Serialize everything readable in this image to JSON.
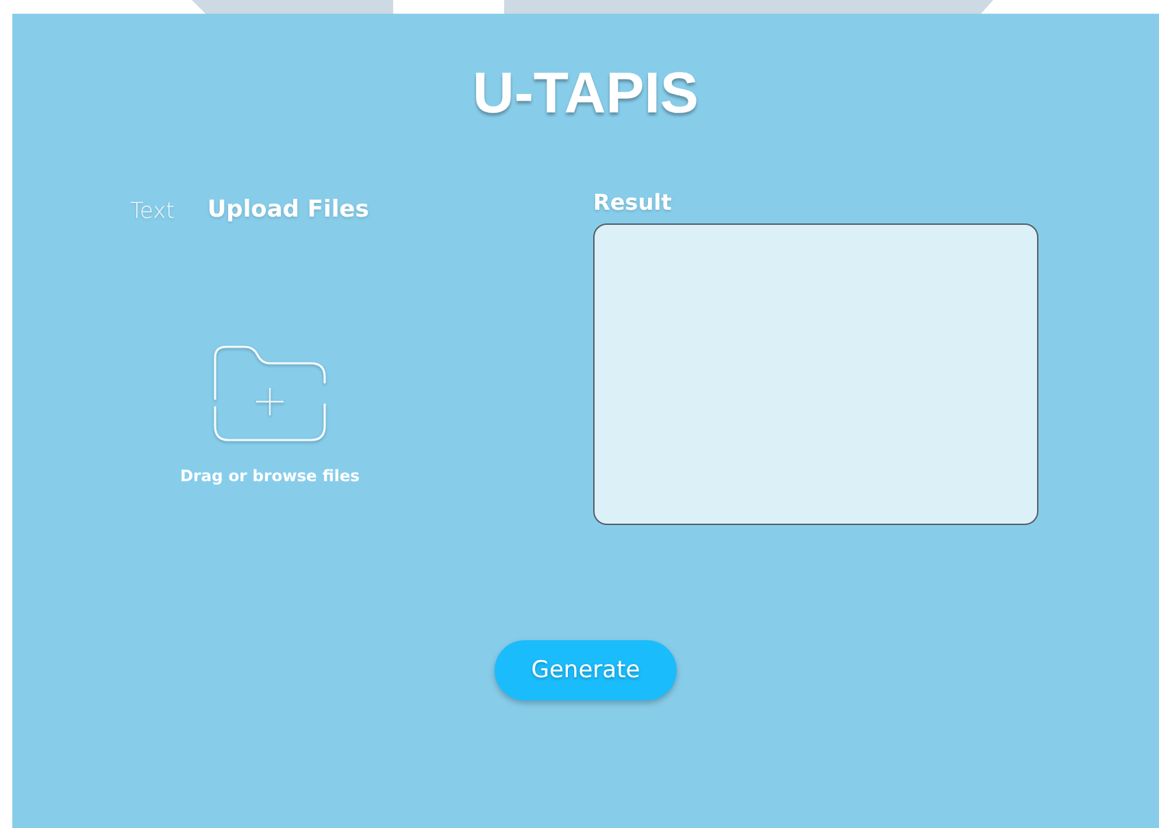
{
  "title": "U-TAPIS",
  "tabs": [
    {
      "label": "Text",
      "selected": false
    },
    {
      "label": "Upload Files",
      "selected": true
    }
  ],
  "upload": {
    "caption": "Drag or browse files"
  },
  "result": {
    "label": "Result"
  },
  "button": "Generate"
}
